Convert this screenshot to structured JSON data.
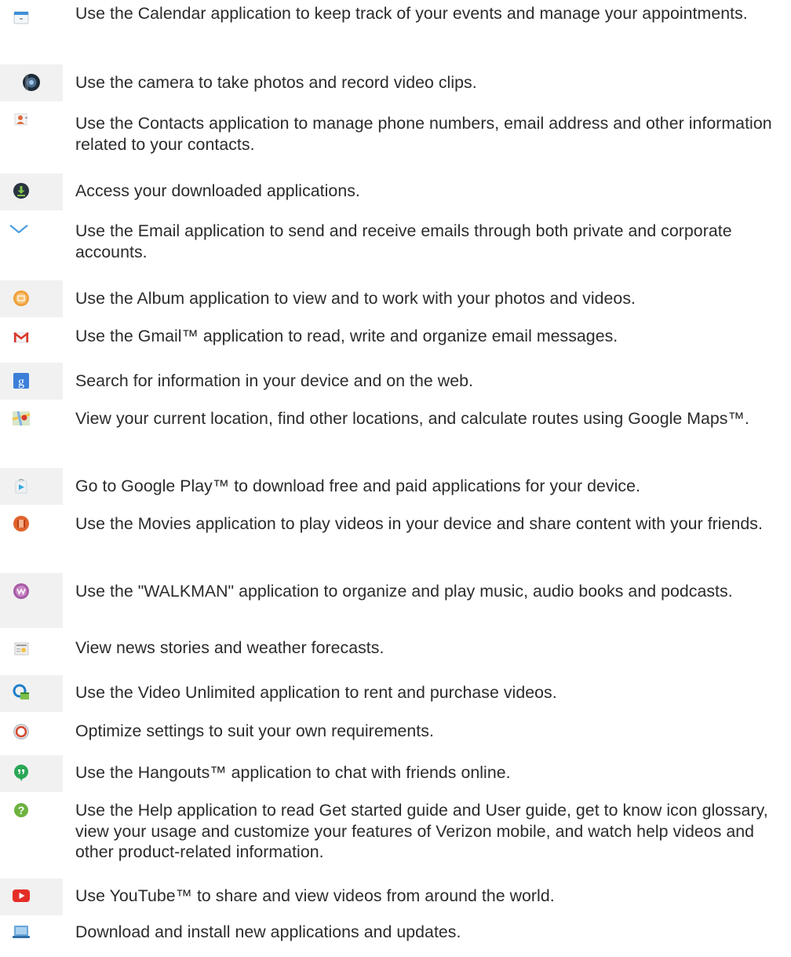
{
  "apps": [
    {
      "icon": "calendar-icon",
      "text": "Use the Calendar application to keep track of your events and manage your appointments."
    },
    {
      "icon": "camera-icon",
      "text": "Use the camera to take photos and record video clips."
    },
    {
      "icon": "contacts-icon",
      "text": "Use the Contacts application to manage phone numbers, email address and other information related to your contacts."
    },
    {
      "icon": "downloads-icon",
      "text": "Access your downloaded applications."
    },
    {
      "icon": "email-icon",
      "text": "Use the Email application to send and receive emails through both private and corporate accounts."
    },
    {
      "icon": "album-icon",
      "text": "Use the Album application to view and to work with your photos and videos."
    },
    {
      "icon": "gmail-icon",
      "text": "Use the Gmail™ application to read, write and organize email messages."
    },
    {
      "icon": "google-search-icon",
      "text": "Search for information in your device and on the web."
    },
    {
      "icon": "maps-icon",
      "text": "View your current location, find other locations, and calculate routes using Google Maps™."
    },
    {
      "icon": "play-store-icon",
      "text": "Go to Google Play™ to download free and paid applications for your device."
    },
    {
      "icon": "movies-icon",
      "text": "Use the Movies application to play videos in your device and share content with your friends."
    },
    {
      "icon": "walkman-icon",
      "text": "Use the \"WALKMAN\" application to organize and play music, audio books and podcasts."
    },
    {
      "icon": "news-weather-icon",
      "text": "View news stories and weather forecasts."
    },
    {
      "icon": "video-unlimited-icon",
      "text": "Use the Video Unlimited application to rent and purchase videos."
    },
    {
      "icon": "settings-icon",
      "text": "Optimize settings to suit your own requirements."
    },
    {
      "icon": "hangouts-icon",
      "text": "Use the Hangouts™ application to chat with friends online."
    },
    {
      "icon": "help-icon",
      "text": "Use the Help application to read Get started guide and User guide, get to know icon glossary, view your usage and customize your features of Verizon mobile, and watch help videos and other product-related information."
    },
    {
      "icon": "youtube-icon",
      "text": "Use YouTube™ to share and view videos from around the world."
    },
    {
      "icon": "update-center-icon",
      "text": "Download and install new applications and updates."
    }
  ]
}
